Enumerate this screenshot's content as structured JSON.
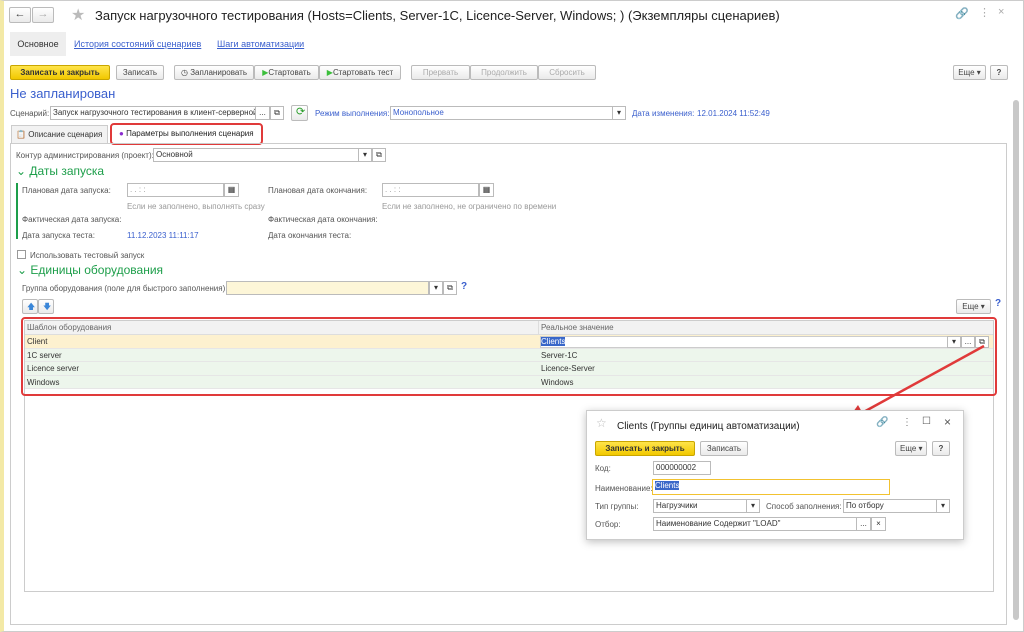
{
  "window": {
    "title": "Запуск нагрузочного тестирования (Hosts=Clients, Server-1C, Licence-Server, Windows; ) (Экземпляры сценариев)"
  },
  "nav_tabs": [
    "Основное",
    "История состояний сценариев",
    "Шаги автоматизации"
  ],
  "toolbar": {
    "save_close": "Записать и закрыть",
    "save": "Записать",
    "schedule": "Запланировать",
    "start": "Стартовать",
    "start_test": "Стартовать тест",
    "abort": "Прервать",
    "continue": "Продолжить",
    "reset": "Сбросить",
    "more": "Еще",
    "help": "?"
  },
  "status": "Не запланирован",
  "scenario": {
    "label": "Сценарий:",
    "value": "Запуск нагрузочного тестирования в клиент-серверной",
    "mode_label": "Режим выполнения:",
    "mode_value": "Монопольное",
    "changed_label": "Дата изменения:",
    "changed_value": "12.01.2024 11:52:49"
  },
  "tabs": [
    "Описание сценария",
    "Параметры выполнения сценария"
  ],
  "params": {
    "contour_label": "Контур администрирования (проект):",
    "contour_value": "Основной",
    "dates_title": "Даты запуска",
    "plan_start_label": "Плановая дата запуска:",
    "plan_start_value": " .  .      :  :",
    "plan_start_hint": "Если не заполнено, выполнять сразу",
    "plan_end_label": "Плановая дата окончания:",
    "plan_end_value": " .  .      :  :",
    "plan_end_hint": "Если не заполнено, не ограничено по времени",
    "fact_start_label": "Фактическая дата запуска:",
    "fact_end_label": "Фактическая дата окончания:",
    "test_start_label": "Дата запуска теста:",
    "test_start_value": "11.12.2023 11:11:17",
    "test_end_label": "Дата окончания теста:",
    "use_test_label": "Использовать тестовый запуск",
    "use_test_checked": false,
    "equipment_title": "Единицы оборудования",
    "group_label": "Группа оборудования (поле для быстрого заполнения):",
    "group_value": "",
    "help": "?",
    "more": "Еще"
  },
  "table": {
    "headers": [
      "Шаблон оборудования",
      "Реальное значение"
    ],
    "rows": [
      [
        "Client",
        "Clients"
      ],
      [
        "1C server",
        "Server-1C"
      ],
      [
        "Licence server",
        "Licence-Server"
      ],
      [
        "Windows",
        "Windows"
      ]
    ]
  },
  "popup": {
    "title": "Clients (Группы единиц автоматизации)",
    "save_close": "Записать и закрыть",
    "save": "Записать",
    "more": "Еще",
    "help": "?",
    "code_label": "Код:",
    "code_value": "000000002",
    "name_label": "Наименование:",
    "name_value": "Clients",
    "type_label": "Тип группы:",
    "type_value": "Нагрузчики",
    "fill_label": "Способ заполнения:",
    "fill_value": "По отбору",
    "filter_label": "Отбор:",
    "filter_value": "Наименование Содержит \"LOAD\""
  },
  "colors": {
    "accent_green": "#1d9e4a",
    "link": "#3a5fcd",
    "highlight": "#e03a3a",
    "primary_button": "#f2c800"
  }
}
